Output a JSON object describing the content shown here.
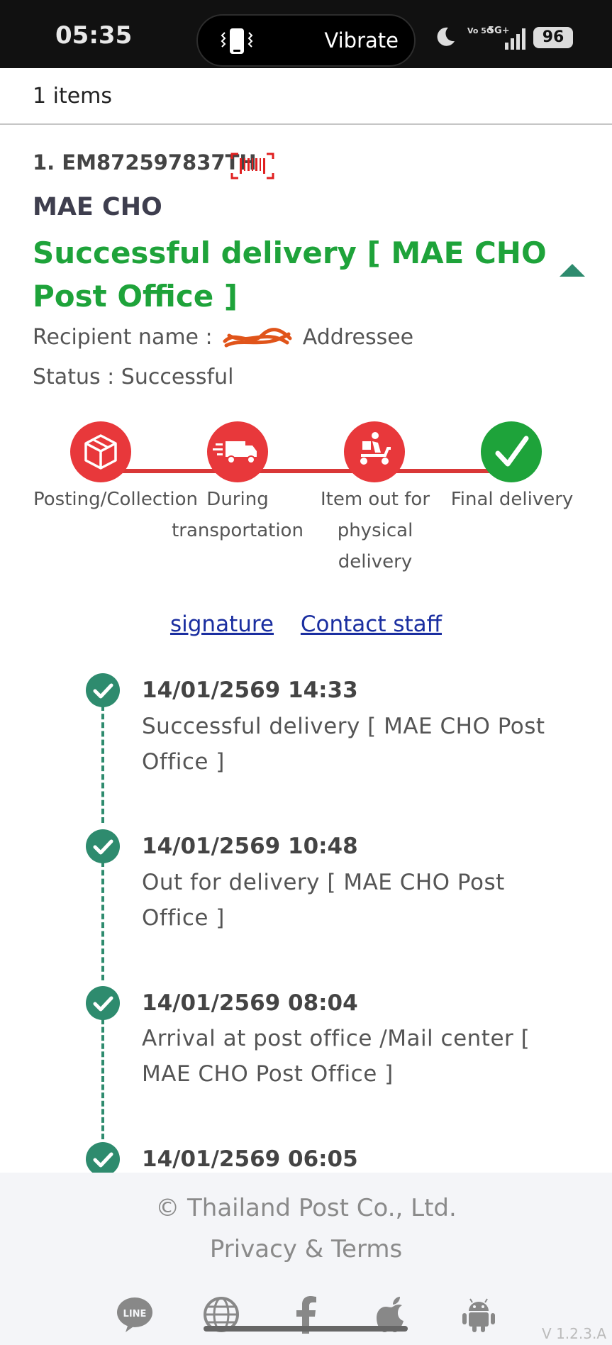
{
  "status_bar": {
    "time": "05:35",
    "island_text": "Vibrate",
    "volte": "Vo 5G",
    "network": "5G+",
    "battery": "96"
  },
  "header": {
    "items_count": "1 items"
  },
  "item": {
    "tracking_line": "1. EM872597837TH",
    "office": "MAE CHO",
    "headline": "Successful delivery [ MAE CHO Post Office ]",
    "recipient_label": "Recipient name :",
    "recipient_value": "Addressee",
    "status_label": "Status : Successful",
    "steps": [
      {
        "label": "Posting/Collection",
        "icon": "package-icon",
        "done": false
      },
      {
        "label": "During transportation",
        "icon": "delivery-truck-icon",
        "done": false
      },
      {
        "label": "Item out for physical delivery",
        "icon": "scooter-courier-icon",
        "done": false
      },
      {
        "label": "Final delivery",
        "icon": "checkmark-icon",
        "done": true
      }
    ],
    "links": {
      "signature": "signature",
      "contact": "Contact staff"
    },
    "timeline": [
      {
        "time": "14/01/2569 14:33",
        "desc": "Successful delivery [ MAE CHO Post Office ]"
      },
      {
        "time": "14/01/2569 10:48",
        "desc": "Out for delivery [ MAE CHO Post Office ]"
      },
      {
        "time": "14/01/2569 08:04",
        "desc": "Arrival at post office /Mail center [ MAE CHO Post Office ]"
      },
      {
        "time": "14/01/2569 06:05",
        "desc": ""
      }
    ]
  },
  "footer": {
    "copyright": "© Thailand Post Co., Ltd.",
    "privacy": "Privacy & Terms",
    "line_label": "LINE",
    "version": "V 1.2.3.A"
  },
  "colors": {
    "success_green": "#1ea33a",
    "step_red": "#e8383b",
    "timeline_teal": "#2e8b6e",
    "link_blue": "#1a2ea0"
  }
}
